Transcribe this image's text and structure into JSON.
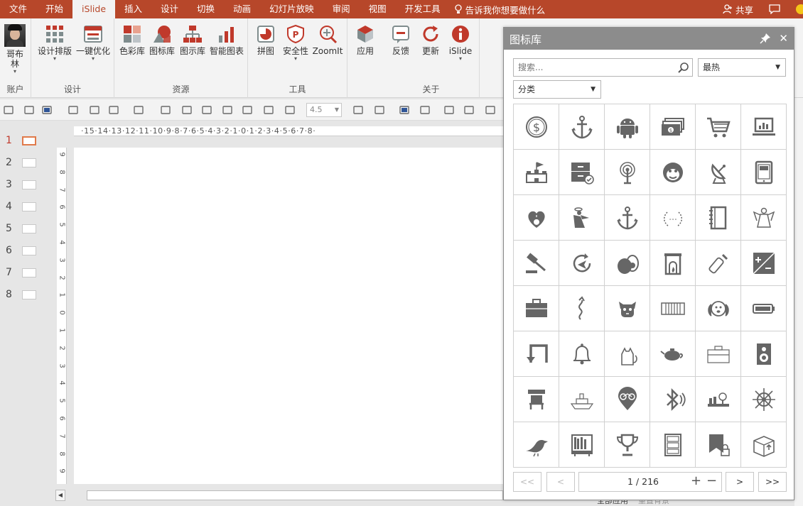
{
  "tabs": [
    {
      "label": "文件"
    },
    {
      "label": "开始"
    },
    {
      "label": "iSlide",
      "active": true
    },
    {
      "label": "插入"
    },
    {
      "label": "设计"
    },
    {
      "label": "切换"
    },
    {
      "label": "动画"
    },
    {
      "label": "幻灯片放映"
    },
    {
      "label": "审阅"
    },
    {
      "label": "视图"
    },
    {
      "label": "开发工具"
    }
  ],
  "tellme": "告诉我你想要做什么",
  "share": "共享",
  "ribbon": {
    "account": {
      "user": "哥布\n林",
      "group": "账户"
    },
    "design": {
      "layout": "设计排版",
      "optimize": "一键优化",
      "group": "设计"
    },
    "resources": {
      "color": "色彩库",
      "icons": "图标库",
      "diagrams": "图示库",
      "charts": "智能图表",
      "group": "资源"
    },
    "tools": {
      "puzzle": "拼图",
      "security": "安全性",
      "zoomit": "ZoomIt",
      "group": "工具"
    },
    "apps": {
      "apply": "应用"
    },
    "about": {
      "feedback": "反馈",
      "update": "更新",
      "islide": "iSlide",
      "group": "关于"
    }
  },
  "qbar": {
    "font_size": "4.5"
  },
  "thumbs": [
    "1",
    "2",
    "3",
    "4",
    "5",
    "6",
    "7",
    "8"
  ],
  "ruler": {
    "h": "·15·14·13·12·11·10·9·8·7·6·5·4·3·2·1·0·1·2·3·4·5·6·7·8·",
    "v": [
      "9",
      "8",
      "7",
      "6",
      "5",
      "4",
      "3",
      "2",
      "1",
      "0",
      "1",
      "2",
      "3",
      "4",
      "5",
      "6",
      "7",
      "8",
      "9"
    ]
  },
  "panel": {
    "title": "图标库",
    "search_placeholder": "搜索...",
    "sort": "最热",
    "category": "分类",
    "page": "1 / 216",
    "first": "<<",
    "prev": "<",
    "next": ">",
    "last": ">>",
    "icons": [
      "dollar-coin",
      "anchor",
      "android",
      "cash-stack",
      "shopping-cart",
      "laptop-chart",
      "castle-flag",
      "archive-box-check",
      "signal-antenna",
      "monkey-face",
      "satellite-dish",
      "tablet-device",
      "heart-apple",
      "angel-figure",
      "anchor",
      "laurel-wreath",
      "notebook",
      "angel-outline",
      "judge-gavel",
      "refresh-plane",
      "avocado",
      "fireplace",
      "baby-bottle",
      "plus-minus-box",
      "briefcase",
      "curvy-arrow",
      "dog-face",
      "radiator",
      "dog-head",
      "battery",
      "corner-arrow",
      "bell",
      "cat",
      "teapot",
      "toolbox",
      "speaker",
      "stand-table",
      "ship",
      "bike-pin",
      "bluetooth-sound",
      "bakery",
      "ship-wheel",
      "bird",
      "bookshelf",
      "trophy",
      "cabinet",
      "bookmark-lock",
      "box-upload"
    ]
  },
  "status": {
    "a": "全部应用",
    "b": "重置背景"
  }
}
